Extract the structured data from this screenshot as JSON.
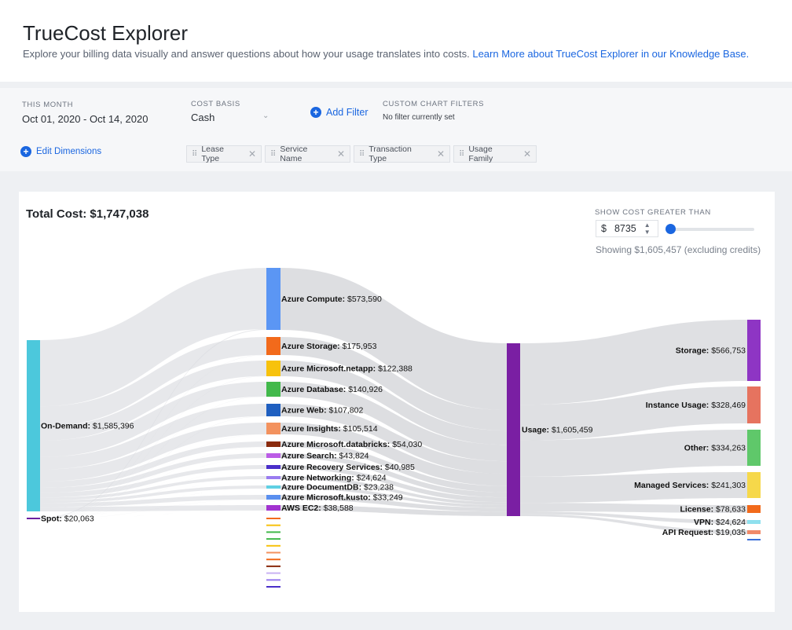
{
  "header": {
    "title": "TrueCost Explorer",
    "description": "Explore your billing data visually and answer questions about how your usage translates into costs.",
    "link_text": "Learn More about TrueCost Explorer in our Knowledge Base."
  },
  "filters": {
    "period_label": "THIS MONTH",
    "period_value": "Oct 01, 2020 - Oct 14, 2020",
    "cost_basis_label": "COST BASIS",
    "cost_basis_value": "Cash",
    "add_filter": "Add Filter",
    "custom_label": "CUSTOM CHART FILTERS",
    "custom_value": "No filter currently set",
    "edit_dimensions": "Edit Dimensions",
    "dimensions": [
      "Lease Type",
      "Service Name",
      "Transaction Type",
      "Usage Family"
    ]
  },
  "summary": {
    "total_label": "Total Cost:",
    "total_value": "$1,747,038",
    "threshold_label": "SHOW COST GREATER THAN",
    "currency": "$",
    "threshold_value": "8735",
    "showing": "Showing $1,605,457 (excluding credits)"
  },
  "chart_data": {
    "type": "sankey",
    "columns": [
      "Lease Type",
      "Service Name",
      "Transaction Type",
      "Usage Family"
    ],
    "nodes": [
      {
        "id": "od",
        "column": 0,
        "name": "On-Demand",
        "value": 1585396,
        "label": "$1,585,396",
        "color": "#4cc8dc"
      },
      {
        "id": "spot",
        "column": 0,
        "name": "Spot",
        "value": 20063,
        "label": "$20,063",
        "color": "#6b1fa0"
      },
      {
        "id": "compute",
        "column": 1,
        "name": "Azure Compute",
        "value": 573590,
        "label": "$573,590",
        "color": "#5b96f4"
      },
      {
        "id": "storage_s",
        "column": 1,
        "name": "Azure Storage",
        "value": 175953,
        "label": "$175,953",
        "color": "#f26a1b"
      },
      {
        "id": "netapp",
        "column": 1,
        "name": "Azure Microsoft.netapp",
        "value": 122388,
        "label": "$122,388",
        "color": "#f7c20d"
      },
      {
        "id": "database",
        "column": 1,
        "name": "Azure Database",
        "value": 140926,
        "label": "$140,926",
        "color": "#42b94b"
      },
      {
        "id": "web",
        "column": 1,
        "name": "Azure Web",
        "value": 107802,
        "label": "$107,802",
        "color": "#1f5fc0"
      },
      {
        "id": "insights",
        "column": 1,
        "name": "Azure Insights",
        "value": 105514,
        "label": "$105,514",
        "color": "#f3925e"
      },
      {
        "id": "databricks",
        "column": 1,
        "name": "Azure Microsoft.databricks",
        "value": 54030,
        "label": "$54,030",
        "color": "#8a2b0e"
      },
      {
        "id": "search",
        "column": 1,
        "name": "Azure Search",
        "value": 43824,
        "label": "$43,824",
        "color": "#bb5ce6"
      },
      {
        "id": "recovery",
        "column": 1,
        "name": "Azure Recovery Services",
        "value": 40985,
        "label": "$40,985",
        "color": "#4a2fc9"
      },
      {
        "id": "networking",
        "column": 1,
        "name": "Azure Networking",
        "value": 24624,
        "label": "$24,624",
        "color": "#9a7cf0"
      },
      {
        "id": "documentdb",
        "column": 1,
        "name": "Azure DocumentDB",
        "value": 23238,
        "label": "$23,238",
        "color": "#5fd0e3"
      },
      {
        "id": "kusto",
        "column": 1,
        "name": "Azure Microsoft.kusto",
        "value": 33249,
        "label": "$33,249",
        "color": "#5a8fef"
      },
      {
        "id": "ec2",
        "column": 1,
        "name": "AWS EC2",
        "value": 38588,
        "label": "$38,588",
        "color": "#a233d0"
      },
      {
        "id": "usage",
        "column": 2,
        "name": "Usage",
        "value": 1605459,
        "label": "$1,605,459",
        "color": "#7a1fa3"
      },
      {
        "id": "storage_f",
        "column": 3,
        "name": "Storage",
        "value": 566753,
        "label": "$566,753",
        "color": "#8e35c4"
      },
      {
        "id": "instance",
        "column": 3,
        "name": "Instance Usage",
        "value": 328469,
        "label": "$328,469",
        "color": "#e6735f"
      },
      {
        "id": "other",
        "column": 3,
        "name": "Other",
        "value": 334263,
        "label": "$334,263",
        "color": "#5fc86a"
      },
      {
        "id": "managed",
        "column": 3,
        "name": "Managed Services",
        "value": 241303,
        "label": "$241,303",
        "color": "#f6d84a"
      },
      {
        "id": "license",
        "column": 3,
        "name": "License",
        "value": 78633,
        "label": "$78,633",
        "color": "#f26a1b"
      },
      {
        "id": "vpn",
        "column": 3,
        "name": "VPN",
        "value": 24624,
        "label": "$24,624",
        "color": "#8fe0ee"
      },
      {
        "id": "api",
        "column": 3,
        "name": "API Request",
        "value": 19035,
        "label": "$19,035",
        "color": "#f08a6a"
      }
    ]
  }
}
